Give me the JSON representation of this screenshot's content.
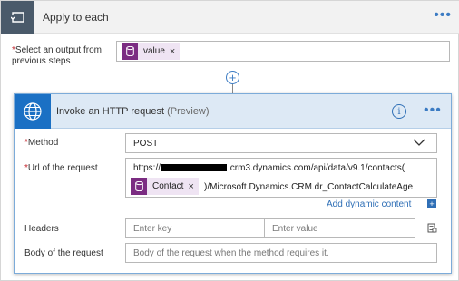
{
  "apply_to_each": {
    "title": "Apply to each",
    "menu_glyph": "•••",
    "select_label_required": "*",
    "select_label": "Select an output from previous steps",
    "token_label": "value",
    "token_remove": "×"
  },
  "add_step_glyph": "+",
  "http_card": {
    "title": "Invoke an HTTP request",
    "subtitle": "(Preview)",
    "info_glyph": "i",
    "menu_glyph": "•••",
    "method": {
      "label": "Method",
      "value": "POST"
    },
    "url": {
      "label": "Url of the request",
      "prefix": "https://",
      "suffix": ".crm3.dynamics.com/api/data/v9.1/contacts(",
      "token_label": "Contact",
      "token_remove": "×",
      "tail": ")/Microsoft.Dynamics.CRM.dr_ContactCalculateAge"
    },
    "add_dynamic_content": "Add dynamic content",
    "add_dynamic_glyph": "+",
    "headers": {
      "label": "Headers",
      "key_placeholder": "Enter key",
      "value_placeholder": "Enter value"
    },
    "body": {
      "label": "Body of the request",
      "placeholder": "Body of the request when the method requires it."
    }
  },
  "colors": {
    "loop_icon_bg": "#4a5a6a",
    "http_icon_bg": "#1b70c4",
    "token_icon_bg": "#7b2c82",
    "token_bg": "#efe4f3",
    "link": "#2f6fb6",
    "required": "#c4262e"
  },
  "icons": [
    "loop-icon",
    "globe-icon",
    "database-icon",
    "info-icon",
    "chevron-down-icon",
    "plus-icon",
    "switch-to-text-icon"
  ]
}
